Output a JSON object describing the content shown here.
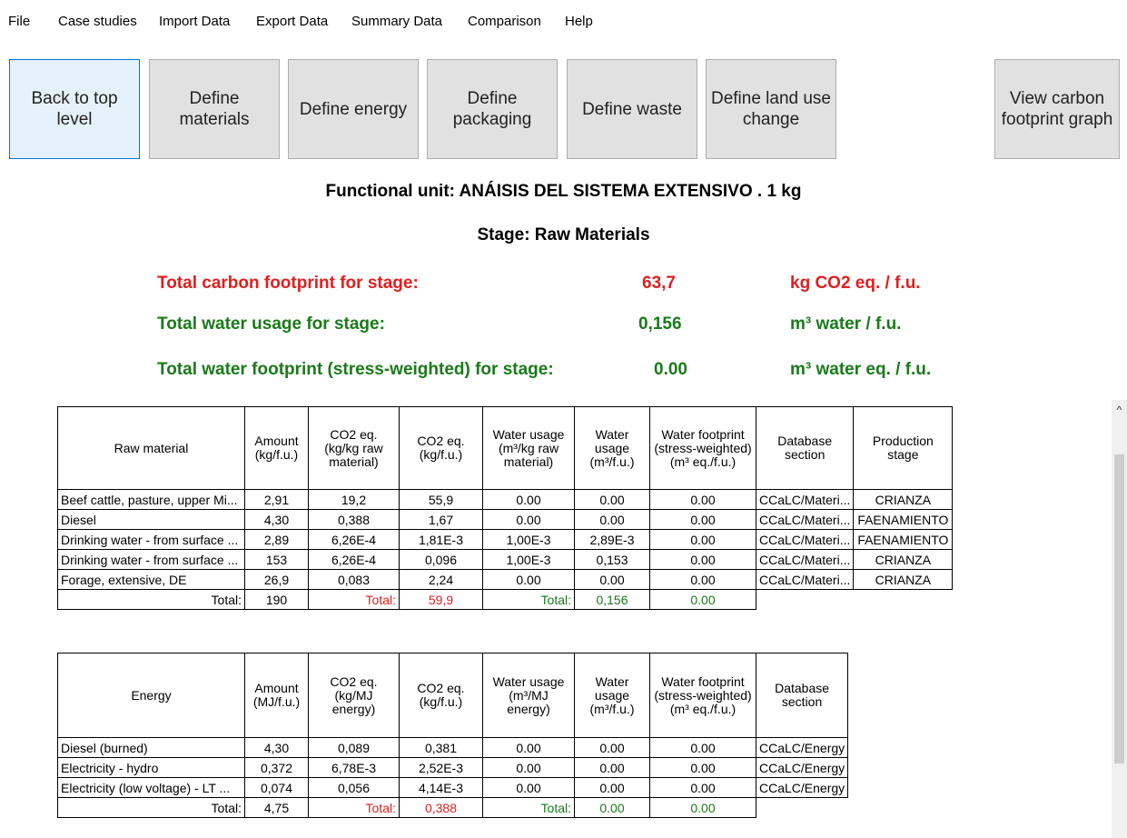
{
  "menu": [
    "File",
    "Case studies",
    "Import Data",
    "Export Data",
    "Summary Data",
    "Comparison",
    "Help"
  ],
  "toolbar": {
    "back": "Back to top\nlevel",
    "materials": "Define\nmaterials",
    "energy": "Define energy",
    "packaging": "Define\npackaging",
    "waste": "Define waste",
    "land": "Define land use\nchange",
    "graph": "View carbon\nfootprint graph"
  },
  "functional_unit": "Functional unit: ANÁISIS DEL SISTEMA EXTENSIVO . 1 kg",
  "stage": "Stage: Raw Materials",
  "summary": {
    "carbon_label": "Total carbon footprint for stage:",
    "carbon_value": "63,7",
    "carbon_unit": "kg CO2 eq. / f.u.",
    "water_label": "Total water usage for stage:",
    "water_value": "0,156",
    "water_unit": "m³ water / f.u.",
    "wf_label": "Total water footprint (stress-weighted) for stage:",
    "wf_value": "0.00",
    "wf_unit": "m³ water eq. / f.u."
  },
  "raw_table": {
    "headers": [
      "Raw material",
      "Amount (kg/f.u.)",
      "CO2 eq. (kg/kg raw material)",
      "CO2 eq. (kg/f.u.)",
      "Water usage (m³/kg raw material)",
      "Water usage (m³/f.u.)",
      "Water footprint (stress-weighted) (m³ eq./f.u.)",
      "Database section",
      "Production stage"
    ],
    "rows": [
      [
        "Beef cattle, pasture, upper Mi...",
        "2,91",
        "19,2",
        "55,9",
        "0.00",
        "0.00",
        "0.00",
        "CCaLC/Materi...",
        "CRIANZA"
      ],
      [
        "Diesel",
        "4,30",
        "0,388",
        "1,67",
        "0.00",
        "0.00",
        "0.00",
        "CCaLC/Materi...",
        "FAENAMIENTO"
      ],
      [
        "Drinking water - from surface ...",
        "2,89",
        "6,26E-4",
        "1,81E-3",
        "1,00E-3",
        "2,89E-3",
        "0.00",
        "CCaLC/Materi...",
        "FAENAMIENTO"
      ],
      [
        "Drinking water - from surface ...",
        "153",
        "6,26E-4",
        "0,096",
        "1,00E-3",
        "0,153",
        "0.00",
        "CCaLC/Materi...",
        "CRIANZA"
      ],
      [
        "Forage, extensive, DE",
        "26,9",
        "0,083",
        "2,24",
        "0.00",
        "0.00",
        "0.00",
        "CCaLC/Materi...",
        "CRIANZA"
      ]
    ],
    "total": {
      "label": "Total:",
      "amount": "190",
      "co2_label": "Total:",
      "co2": "59,9",
      "water_label": "Total:",
      "water": "0,156",
      "wf": "0.00"
    }
  },
  "energy_table": {
    "headers": [
      "Energy",
      "Amount (MJ/f.u.)",
      "CO2 eq. (kg/MJ energy)",
      "CO2 eq. (kg/f.u.)",
      "Water usage (m³/MJ energy)",
      "Water usage (m³/f.u.)",
      "Water footprint (stress-weighted) (m³ eq./f.u.)",
      "Database section"
    ],
    "rows": [
      [
        "Diesel (burned)",
        "4,30",
        "0,089",
        "0,381",
        "0.00",
        "0.00",
        "0.00",
        "CCaLC/Energy"
      ],
      [
        "Electricity - hydro",
        "0,372",
        "6,78E-3",
        "2,52E-3",
        "0.00",
        "0.00",
        "0.00",
        "CCaLC/Energy"
      ],
      [
        "Electricity (low voltage) - LT ...",
        "0,074",
        "0,056",
        "4,14E-3",
        "0.00",
        "0.00",
        "0.00",
        "CCaLC/Energy"
      ]
    ],
    "total": {
      "label": "Total:",
      "amount": "4,75",
      "co2_label": "Total:",
      "co2": "0,388",
      "water_label": "Total:",
      "water": "0.00",
      "wf": "0.00"
    }
  },
  "scrollbar": {
    "up_icon": "chevron-up-icon"
  },
  "colors": {
    "red": "#e01f1f",
    "green": "#1a7a1a",
    "active_button": "#e5f1fb"
  }
}
